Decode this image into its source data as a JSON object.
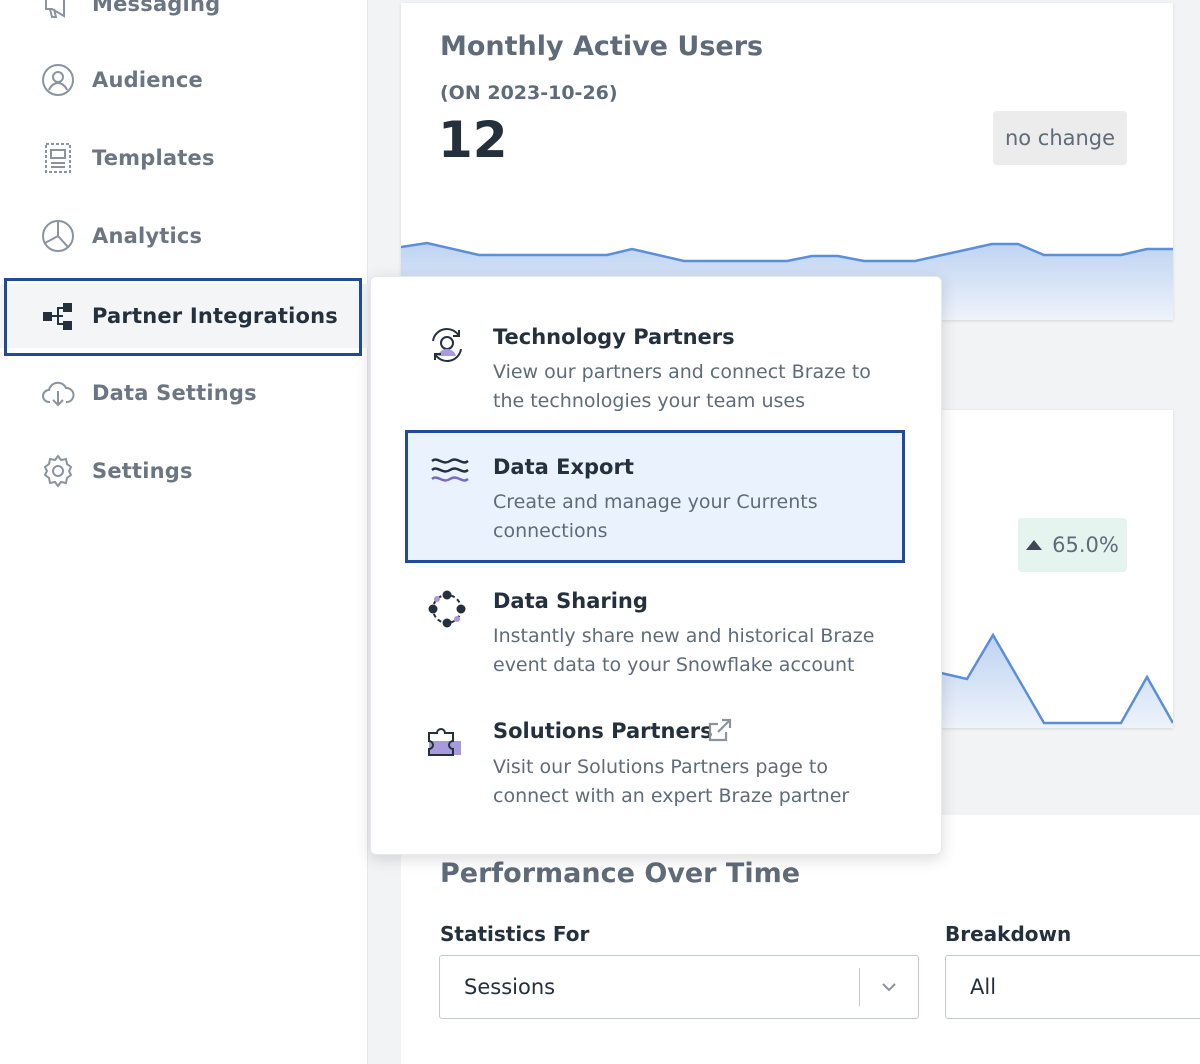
{
  "sidebar": {
    "items": [
      {
        "label": "Messaging",
        "icon": "megaphone-icon"
      },
      {
        "label": "Audience",
        "icon": "user-circle-icon"
      },
      {
        "label": "Templates",
        "icon": "template-icon"
      },
      {
        "label": "Analytics",
        "icon": "pie-chart-icon"
      },
      {
        "label": "Partner Integrations",
        "icon": "integrations-icon"
      },
      {
        "label": "Data Settings",
        "icon": "cloud-download-icon"
      },
      {
        "label": "Settings",
        "icon": "gear-icon"
      }
    ]
  },
  "mau_card": {
    "title": "Monthly Active Users",
    "subtitle": "(ON 2023-10-26)",
    "value": "12",
    "badge": "no change"
  },
  "second_card": {
    "badge": "65.0%"
  },
  "menu": {
    "items": [
      {
        "title": "Technology Partners",
        "description": "View our partners and connect Braze to the technologies your team uses",
        "icon": "technology-partners-icon"
      },
      {
        "title": "Data Export",
        "description": "Create and manage your Currents connections",
        "icon": "data-export-waves-icon"
      },
      {
        "title": "Data Sharing",
        "description": "Instantly share new and historical Braze event data to your Snowflake account",
        "icon": "data-sharing-network-icon"
      },
      {
        "title": "Solutions Partners",
        "description": "Visit our Solutions Partners page to connect with an expert Braze partner",
        "icon": "puzzle-piece-icon"
      }
    ]
  },
  "performance": {
    "title": "Performance Over Time",
    "statistics_label": "Statistics For",
    "statistics_value": "Sessions",
    "breakdown_label": "Breakdown",
    "breakdown_value": "All"
  },
  "colors": {
    "accent": "#1f4b99",
    "chart_line": "#5b8fd8",
    "chart_fill": "#c9daf5",
    "positive_badge": "#e6f4ef"
  }
}
